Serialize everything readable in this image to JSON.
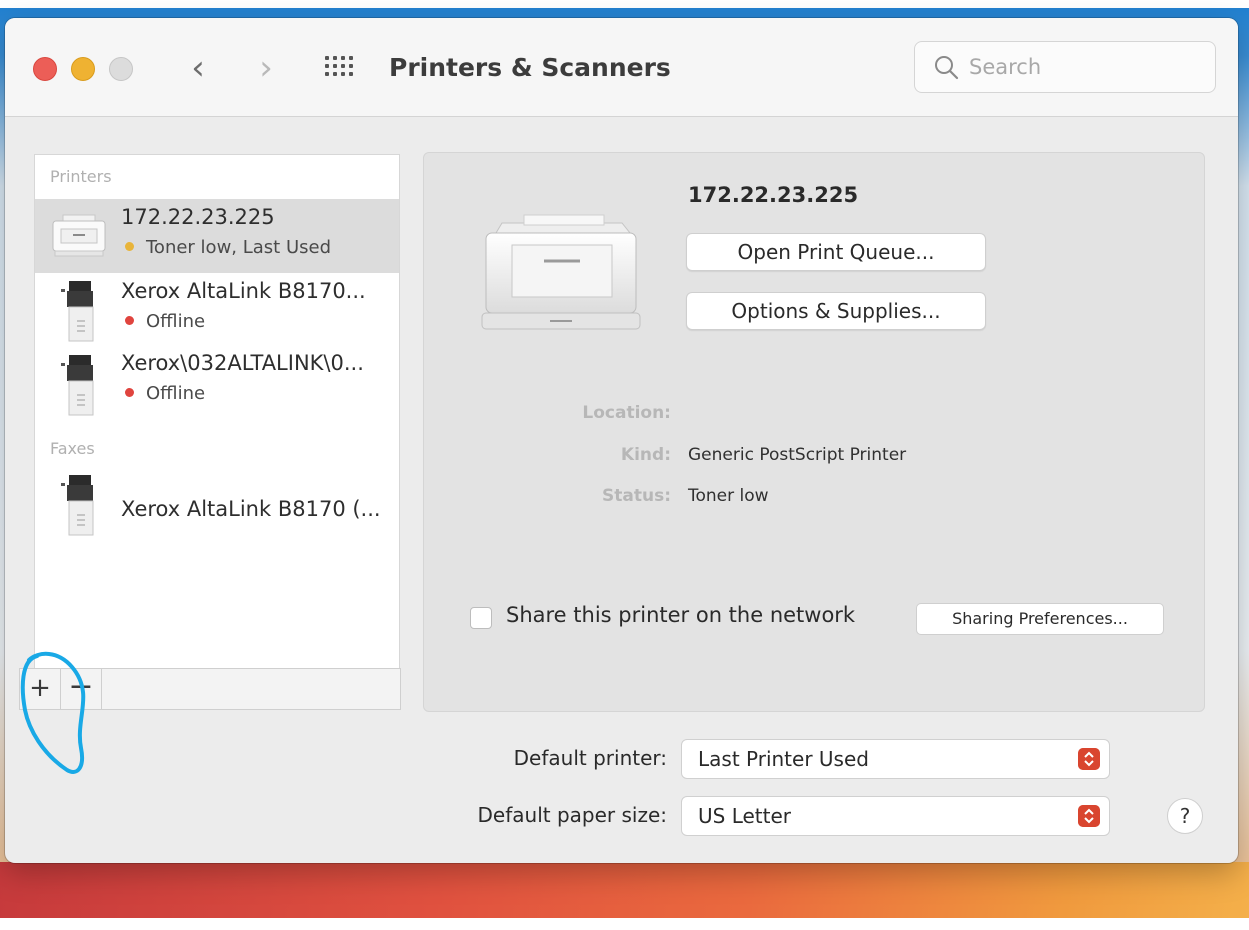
{
  "window": {
    "title": "Printers & Scanners"
  },
  "toolbar": {
    "back_icon": "chevron-left-icon",
    "forward_icon": "chevron-right-icon",
    "grid_icon": "show-all-grid-icon",
    "search_placeholder": "Search"
  },
  "sidebar": {
    "printers_header": "Printers",
    "faxes_header": "Faxes",
    "printers": [
      {
        "name": "172.22.23.225",
        "status": "Toner low, Last Used",
        "status_color": "#e8b43a",
        "selected": true
      },
      {
        "name": "Xerox AltaLink B8170...",
        "status": "Offline",
        "status_color": "#e0443e",
        "selected": false
      },
      {
        "name": "Xerox\\032ALTALINK\\0...",
        "status": "Offline",
        "status_color": "#e0443e",
        "selected": false
      }
    ],
    "faxes": [
      {
        "name": "Xerox AltaLink B8170 (..."
      }
    ],
    "add_label": "+",
    "remove_label": "−"
  },
  "detail": {
    "name": "172.22.23.225",
    "open_queue_label": "Open Print Queue...",
    "options_label": "Options & Supplies...",
    "location_label": "Location:",
    "location_value": "",
    "kind_label": "Kind:",
    "kind_value": "Generic PostScript Printer",
    "status_label": "Status:",
    "status_value": "Toner low",
    "share_label": "Share this printer on the network",
    "share_checked": false,
    "sharing_prefs_label": "Sharing Preferences..."
  },
  "footer": {
    "default_printer_label": "Default printer:",
    "default_printer_value": "Last Printer Used",
    "default_paper_label": "Default paper size:",
    "default_paper_value": "US Letter",
    "help_label": "?"
  },
  "colors": {
    "accent_popup": "#d9452f",
    "annotation": "#19a9e6"
  }
}
